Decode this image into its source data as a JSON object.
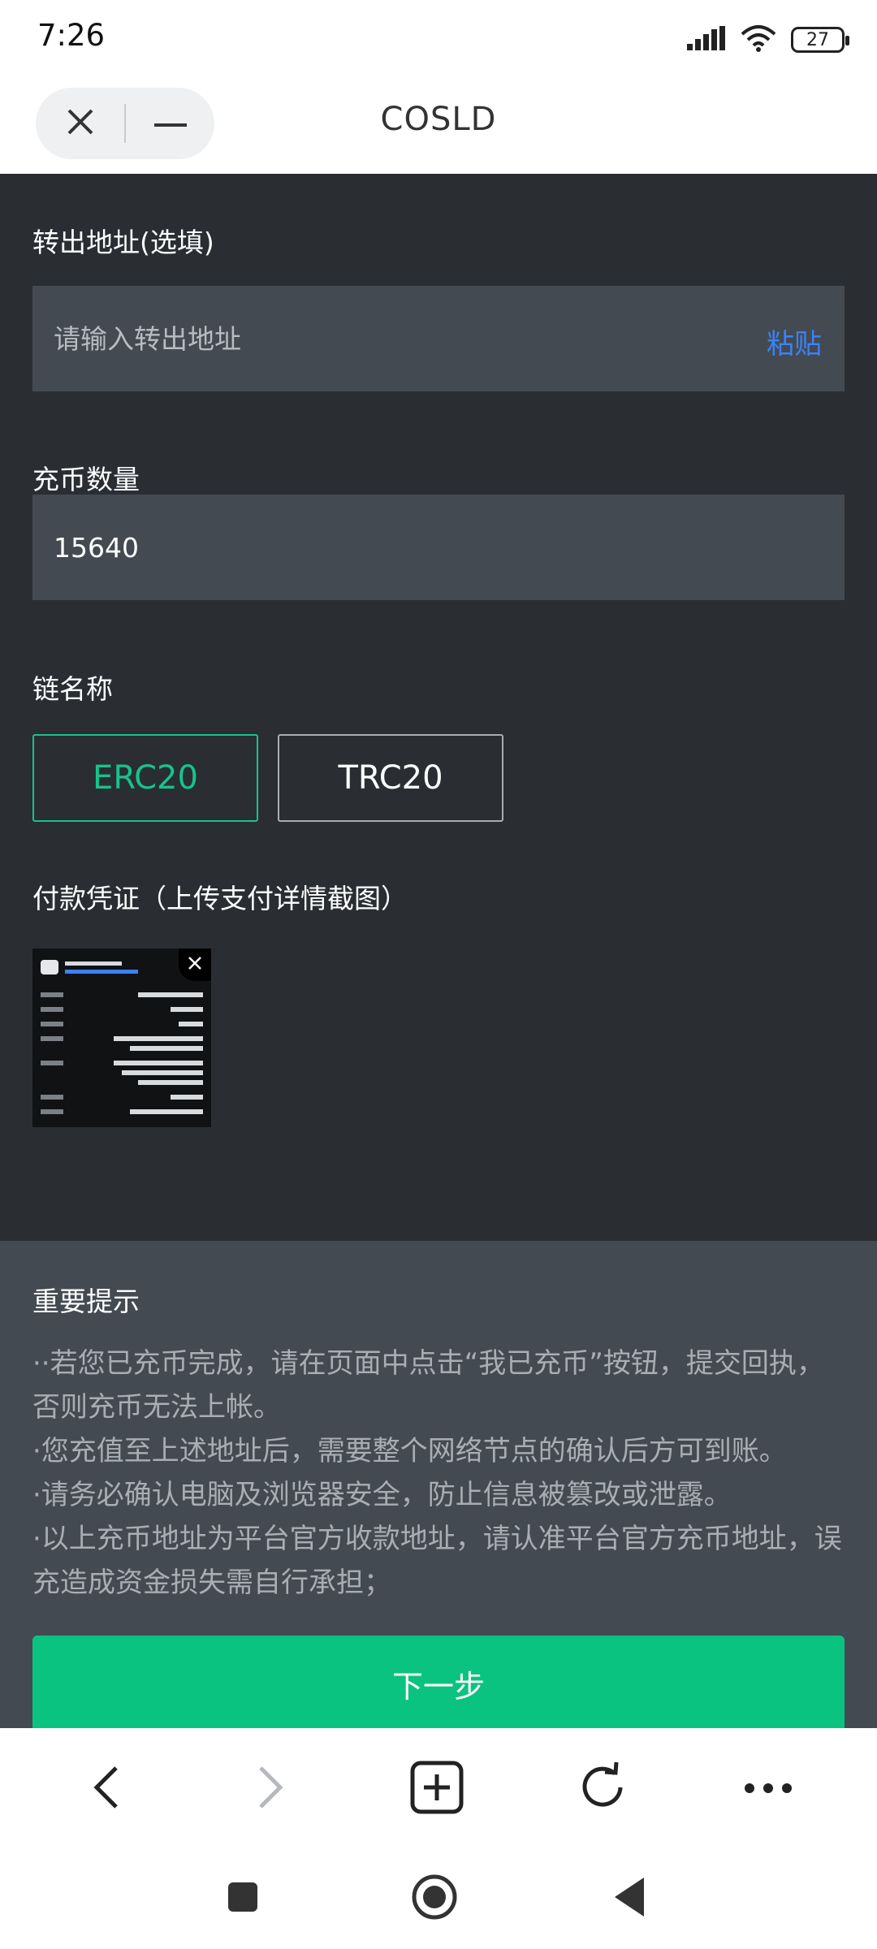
{
  "status": {
    "time": "7:26",
    "battery": "27"
  },
  "header": {
    "title": "COSLD"
  },
  "form": {
    "address_label": "转出地址(选填)",
    "address_placeholder": "请输入转出地址",
    "address_value": "",
    "paste_label": "粘贴",
    "amount_label": "充币数量",
    "amount_value": "15640",
    "chain_label": "链名称",
    "chains": [
      {
        "label": "ERC20",
        "selected": true
      },
      {
        "label": "TRC20",
        "selected": false
      }
    ],
    "voucher_label": "付款凭证（上传支付详情截图）"
  },
  "notice": {
    "title": "重要提示",
    "lines": [
      "··若您已充币完成，请在页面中点击“我已充币”按钮，提交回执，否则充币无法上帐。",
      "·您充值至上述地址后，需要整个网络节点的确认后方可到账。",
      "·请务必确认电脑及浏览器安全，防止信息被篡改或泄露。",
      "·以上充币地址为平台官方收款地址，请认准平台官方充币地址，误充造成资金损失需自行承担；"
    ]
  },
  "actions": {
    "next_label": "下一步"
  },
  "colors": {
    "accent": "#17c38a",
    "button": "#0bc380",
    "link": "#3b82f6",
    "panel": "#434a52",
    "background": "#2a2e33"
  },
  "icons": {
    "status": [
      "signal-icon",
      "wifi-icon",
      "battery-icon"
    ],
    "capsule": [
      "close-icon",
      "minimize-icon"
    ],
    "browser": [
      "back-icon",
      "forward-icon",
      "new-tab-icon",
      "refresh-icon",
      "more-icon"
    ],
    "system": [
      "recents-icon",
      "home-icon",
      "nav-back-icon"
    ]
  }
}
